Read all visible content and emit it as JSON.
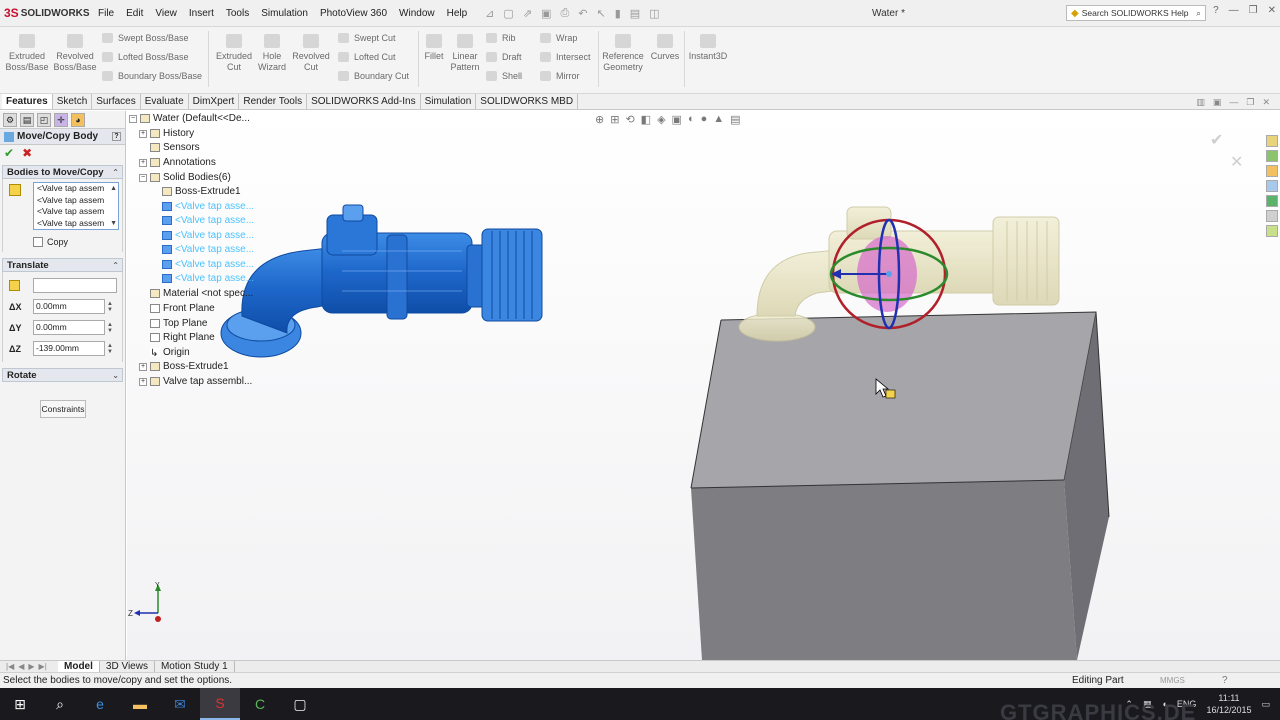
{
  "app": {
    "name": "SOLIDWORKS",
    "logo_symbol": "3S",
    "document_title": "Water *"
  },
  "menu": [
    "File",
    "Edit",
    "View",
    "Insert",
    "Tools",
    "Simulation",
    "PhotoView 360",
    "Window",
    "Help"
  ],
  "search": {
    "placeholder": "Search SOLIDWORKS Help"
  },
  "ribbon": {
    "extruded_boss": "Extruded Boss/Base",
    "revolved_boss": "Revolved Boss/Base",
    "swept_boss": "Swept Boss/Base",
    "lofted_boss": "Lofted Boss/Base",
    "boundary_boss": "Boundary Boss/Base",
    "extruded_cut": "Extruded Cut",
    "hole_wizard": "Hole Wizard",
    "revolved_cut": "Revolved Cut",
    "swept_cut": "Swept Cut",
    "lofted_cut": "Lofted Cut",
    "boundary_cut": "Boundary Cut",
    "fillet": "Fillet",
    "linear_pattern": "Linear Pattern",
    "rib": "Rib",
    "draft": "Draft",
    "shell": "Shell",
    "wrap": "Wrap",
    "intersect": "Intersect",
    "mirror": "Mirror",
    "reference_geometry": "Reference Geometry",
    "curves": "Curves",
    "instant3d": "Instant3D"
  },
  "command_tabs": [
    "Features",
    "Sketch",
    "Surfaces",
    "Evaluate",
    "DimXpert",
    "Render Tools",
    "SOLIDWORKS Add-Ins",
    "Simulation",
    "SOLIDWORKS MBD"
  ],
  "property_manager": {
    "title": "Move/Copy Body",
    "bodies_group": "Bodies to Move/Copy",
    "bodies": [
      "<Valve tap assem",
      "<Valve tap assem",
      "<Valve tap assem",
      "<Valve tap assem"
    ],
    "copy_label": "Copy",
    "translate_group": "Translate",
    "dx_label": "ΔX",
    "dx_value": "0.00mm",
    "dy_label": "ΔY",
    "dy_value": "0.00mm",
    "dz_label": "ΔZ",
    "dz_value": "-139.00mm",
    "rotate_group": "Rotate",
    "constraints_button": "Constraints"
  },
  "feature_tree": {
    "root": "Water  (Default<<De...",
    "history": "History",
    "sensors": "Sensors",
    "annotations": "Annotations",
    "solid_bodies": "Solid Bodies(6)",
    "boss_body": "Boss-Extrude1",
    "valve_bodies": [
      "<Valve tap asse...",
      "<Valve tap asse...",
      "<Valve tap asse...",
      "<Valve tap asse...",
      "<Valve tap asse...",
      "<Valve tap asse..."
    ],
    "material": "Material <not spec...",
    "front_plane": "Front Plane",
    "top_plane": "Top Plane",
    "right_plane": "Right Plane",
    "origin": "Origin",
    "boss_extrude": "Boss-Extrude1",
    "valve_assembly": "Valve tap assembl..."
  },
  "triad": {
    "y": "Y",
    "z": "Z"
  },
  "bottom_tabs": [
    "Model",
    "3D Views",
    "Motion Study 1"
  ],
  "status": {
    "message": "Select the bodies to move/copy and set the options.",
    "mode": "Editing Part",
    "units": "MMGS"
  },
  "taskbar": {
    "language": "ENG",
    "time": "11:11",
    "date": "16/12/2015"
  },
  "watermark": "GTGRAPHICS.DE",
  "colors": {
    "selection_blue": "#1e72d6",
    "ghost_body": "#e9e5c3",
    "box_grey": "#9c9ca0",
    "accent_red": "#c8102e"
  }
}
